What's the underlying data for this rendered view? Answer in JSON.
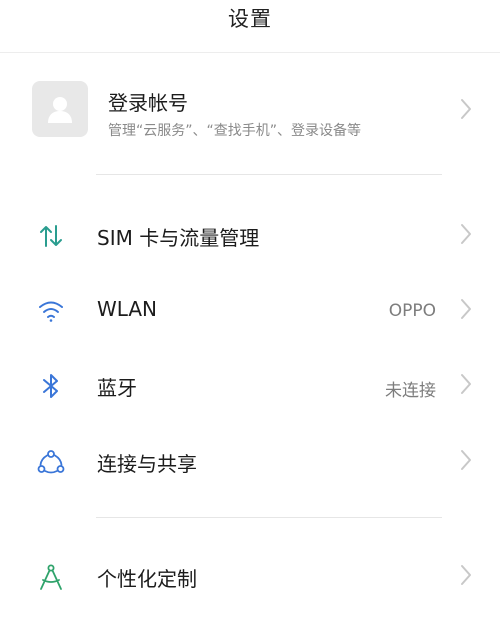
{
  "header": {
    "title": "设置"
  },
  "account": {
    "title": "登录帐号",
    "subtitle": "管理“云服务”、“查找手机”、登录设备等",
    "avatar_icon": "person-icon"
  },
  "rows": [
    {
      "label": "SIM 卡与流量管理",
      "value": "",
      "icon": "sim-data-transfer-icon",
      "icon_color": "#2a9d8f"
    },
    {
      "label": "WLAN",
      "value": "OPPO",
      "icon": "wifi-icon",
      "icon_color": "#3a76d8"
    },
    {
      "label": "蓝牙",
      "value": "未连接",
      "icon": "bluetooth-icon",
      "icon_color": "#3a76d8"
    },
    {
      "label": "连接与共享",
      "value": "",
      "icon": "share-connect-icon",
      "icon_color": "#3a76d8"
    },
    {
      "label": "个性化定制",
      "value": "",
      "icon": "compass-icon",
      "icon_color": "#2fa36b"
    }
  ],
  "colors": {
    "chevron": "#c8c8c8",
    "divider": "#e6e6e6",
    "secondary_text": "#8a8a8a"
  }
}
